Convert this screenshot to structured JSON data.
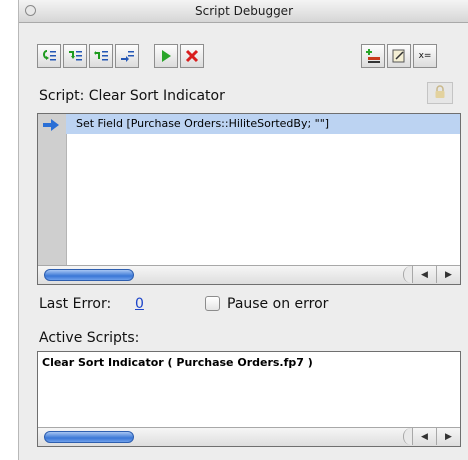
{
  "window": {
    "title": "Script Debugger"
  },
  "toolbar": {
    "buttons": [
      {
        "name": "step-into",
        "icon": "step-into-icon"
      },
      {
        "name": "step-over",
        "icon": "step-over-icon"
      },
      {
        "name": "step-out",
        "icon": "step-out-icon"
      },
      {
        "name": "set-next-step",
        "icon": "set-next-step-icon"
      },
      {
        "name": "run",
        "icon": "play-icon",
        "color": "#2aa52a"
      },
      {
        "name": "halt",
        "icon": "close-x-icon",
        "color": "#d91e1e"
      },
      {
        "name": "edit-script",
        "icon": "edit-script-icon"
      },
      {
        "name": "set-breakpoint",
        "icon": "breakpoint-icon"
      },
      {
        "name": "data-viewer",
        "icon": "data-viewer-icon",
        "label": "x="
      }
    ]
  },
  "script": {
    "label": "Script: Clear Sort Indicator",
    "lock_icon": "lock-icon",
    "steps": [
      {
        "text": "Set Field [Purchase Orders::HiliteSortedBy; \"\"]",
        "current": true
      }
    ]
  },
  "error": {
    "label": "Last Error:",
    "value": "0",
    "pause_label": "Pause on error",
    "pause_checked": false
  },
  "active_scripts": {
    "label": "Active Scripts:",
    "items": [
      "Clear Sort Indicator ( Purchase Orders.fp7 )"
    ]
  },
  "colors": {
    "selection": "#bcd3f2",
    "arrow": "#2a6fd6",
    "link": "#1c44c9"
  }
}
